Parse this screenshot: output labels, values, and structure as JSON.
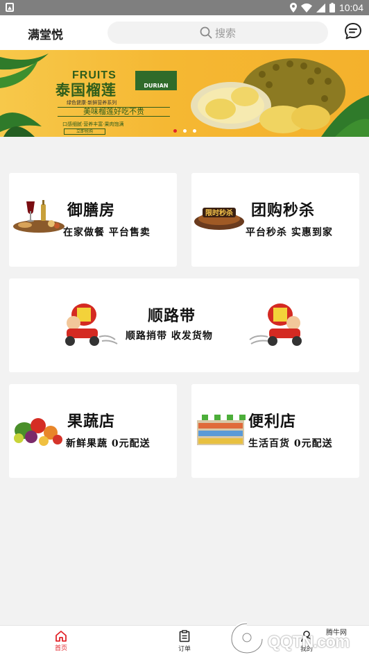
{
  "status_bar": {
    "time": "10:04"
  },
  "header": {
    "title": "满堂悦",
    "search_placeholder": "搜索"
  },
  "banner": {
    "fruits": "FRUITS",
    "brand_box": "DURIAN",
    "title_cn": "泰国榴莲",
    "tagline": "绿色健康·新鲜营养系列",
    "slogan": "美味榴莲好吃不贵",
    "sub": "口感细腻·营养丰富·果肉饱满",
    "cta": "立即抢购",
    "dots": 3,
    "active_dot": 0
  },
  "cards": [
    {
      "title": "御膳房",
      "desc": "在家做餐  平台售卖"
    },
    {
      "title": "团购秒杀",
      "desc": "平台秒杀  实惠到家"
    },
    {
      "title": "顺路带",
      "desc": "顺路捎带  收发货物"
    },
    {
      "title": "果蔬店",
      "desc": "新鲜果蔬  0元配送"
    },
    {
      "title": "便利店",
      "desc": "生活百货  0元配送"
    }
  ],
  "bottom_nav": [
    {
      "label": "首页",
      "icon": "home-icon",
      "active": true
    },
    {
      "label": "订单",
      "icon": "order-icon",
      "active": false
    },
    {
      "label": "我的",
      "icon": "profile-icon",
      "active": false
    }
  ],
  "watermark": {
    "brand": "腾牛网",
    "logo": "QQTN.com"
  },
  "colors": {
    "accent": "#e2242a",
    "background": "#f2f2f2",
    "banner": "#f5b833"
  }
}
